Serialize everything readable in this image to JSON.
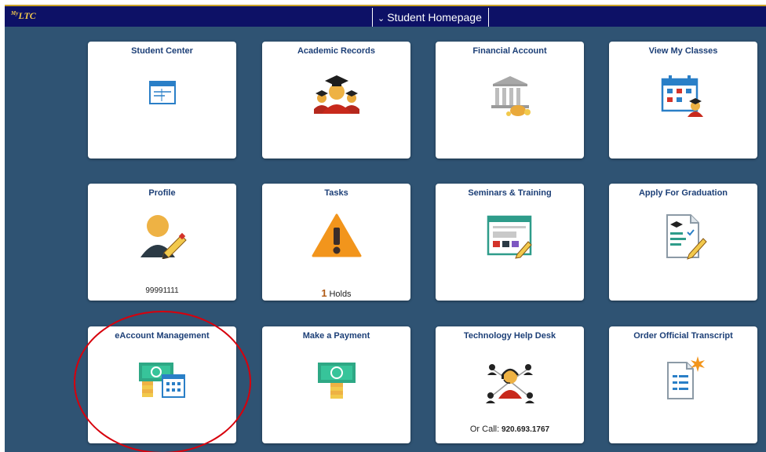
{
  "header": {
    "logo_main": "LTC",
    "logo_sup": "My",
    "page_title": "Student Homepage"
  },
  "tiles": [
    {
      "title": "Student Center",
      "icon": "window-icon"
    },
    {
      "title": "Academic Records",
      "icon": "graduates-icon"
    },
    {
      "title": "Financial Account",
      "icon": "bank-icon"
    },
    {
      "title": "View My Classes",
      "icon": "class-calendar-icon"
    },
    {
      "title": "Profile",
      "icon": "user-edit-icon",
      "footer": "99991111"
    },
    {
      "title": "Tasks",
      "icon": "warning-icon",
      "footer_count": "1",
      "footer": "Holds"
    },
    {
      "title": "Seminars & Training",
      "icon": "training-screen-icon"
    },
    {
      "title": "Apply For Graduation",
      "icon": "graduation-form-icon"
    },
    {
      "title": "eAccount Management",
      "icon": "money-calendar-icon"
    },
    {
      "title": "Make a Payment",
      "icon": "money-icon"
    },
    {
      "title": "Technology Help Desk",
      "icon": "help-desk-icon",
      "footer_prefix": "Or Call:",
      "footer": "920.693.1767"
    },
    {
      "title": "Order Official Transcript",
      "icon": "transcript-icon"
    }
  ],
  "colors": {
    "header_bg": "#0d1166",
    "main_bg": "#2f5373",
    "tile_title": "#1c3f77",
    "annotation_circle": "#d7000c"
  }
}
